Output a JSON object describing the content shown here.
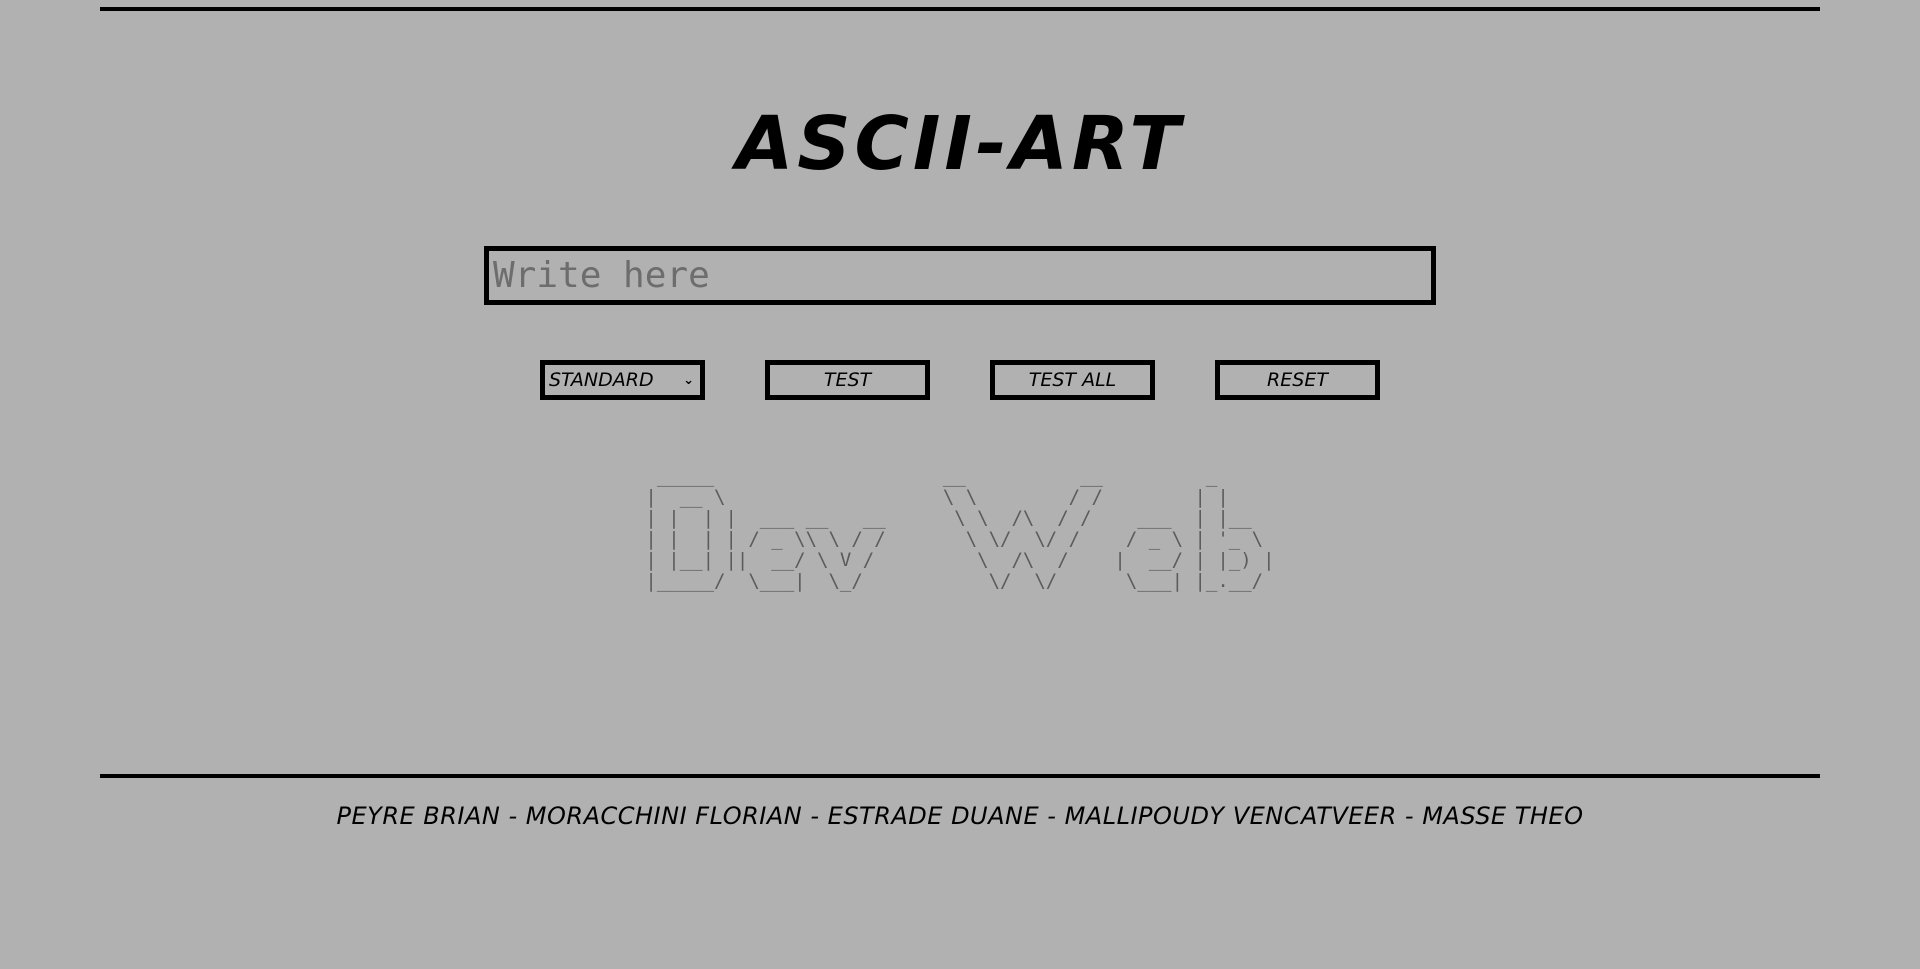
{
  "header": {
    "title": "ASCII-ART"
  },
  "input": {
    "placeholder": "Write here",
    "value": ""
  },
  "controls": {
    "banner_select": {
      "selected": "STANDARD",
      "chevron_icon": "chevron-down-icon"
    },
    "test_label": "TEST",
    "test_all_label": "TEST ALL",
    "reset_label": "RESET"
  },
  "output": {
    "text": "Dev Web",
    "ascii": " _____                    __          __         _     \n|  __ \\                   \\ \\        / /        | |    \n| |  | |  ___ __   __      \\ \\  /\\  / /    ___  | |__  \n| |  | | / _ \\\\ \\ / /       \\ \\/  \\/ /    / _ \\ | '_ \\ \n| |__| ||  __/ \\ V /         \\  /\\  /    |  __/ | |_) |\n|_____/  \\___|  \\_/           \\/  \\/      \\___| |_.__/ "
  },
  "footer": {
    "credits": "PEYRE BRIAN - MORACCHINI FLORIAN - ESTRADE DUANE - MALLIPOUDY VENCATVEER - MASSE THEO"
  },
  "colors": {
    "background": "#b1b1b1",
    "foreground": "#000000",
    "placeholder": "#6d6d6d",
    "ascii": "#5c5c5c"
  }
}
